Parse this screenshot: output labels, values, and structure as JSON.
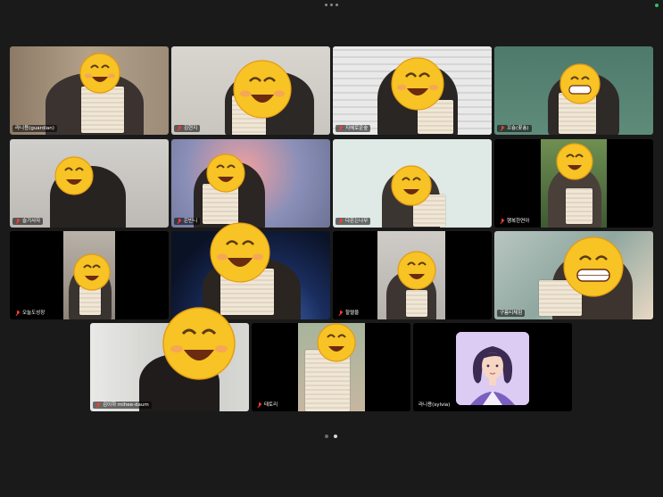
{
  "participants": [
    {
      "name": "라니용(guardian)",
      "muted": false
    },
    {
      "name": "김현지",
      "muted": true
    },
    {
      "name": "지혜로운숲",
      "muted": true
    },
    {
      "name": "꼬숑(꽃숑)",
      "muted": true
    },
    {
      "name": "슬기사자",
      "muted": true
    },
    {
      "name": "은빈니",
      "muted": true
    },
    {
      "name": "다온는나무",
      "muted": true
    },
    {
      "name": "행복한연아",
      "muted": true
    },
    {
      "name": "오늘도성장",
      "muted": true
    },
    {
      "name": "",
      "muted": false
    },
    {
      "name": "할렐율",
      "muted": true
    },
    {
      "name": "구름티체험",
      "muted": false
    },
    {
      "name": "김이하 mihee-daum",
      "muted": true
    },
    {
      "name": "태토리",
      "muted": true
    },
    {
      "name": "라니용(sylvia)",
      "muted": false
    }
  ],
  "active_speaker": "지혜로운숲",
  "colors": {
    "active_border": "#39d463",
    "background": "#1a1a1a",
    "muted_mic": "#ff3b30"
  },
  "icons": {
    "emoji_overlay": "smiling-face-emoji-icon",
    "mic_off": "mic-off-icon",
    "avatar": "cartoon-woman-avatar"
  },
  "pagination": {
    "pages": 2,
    "current_page": 2
  }
}
